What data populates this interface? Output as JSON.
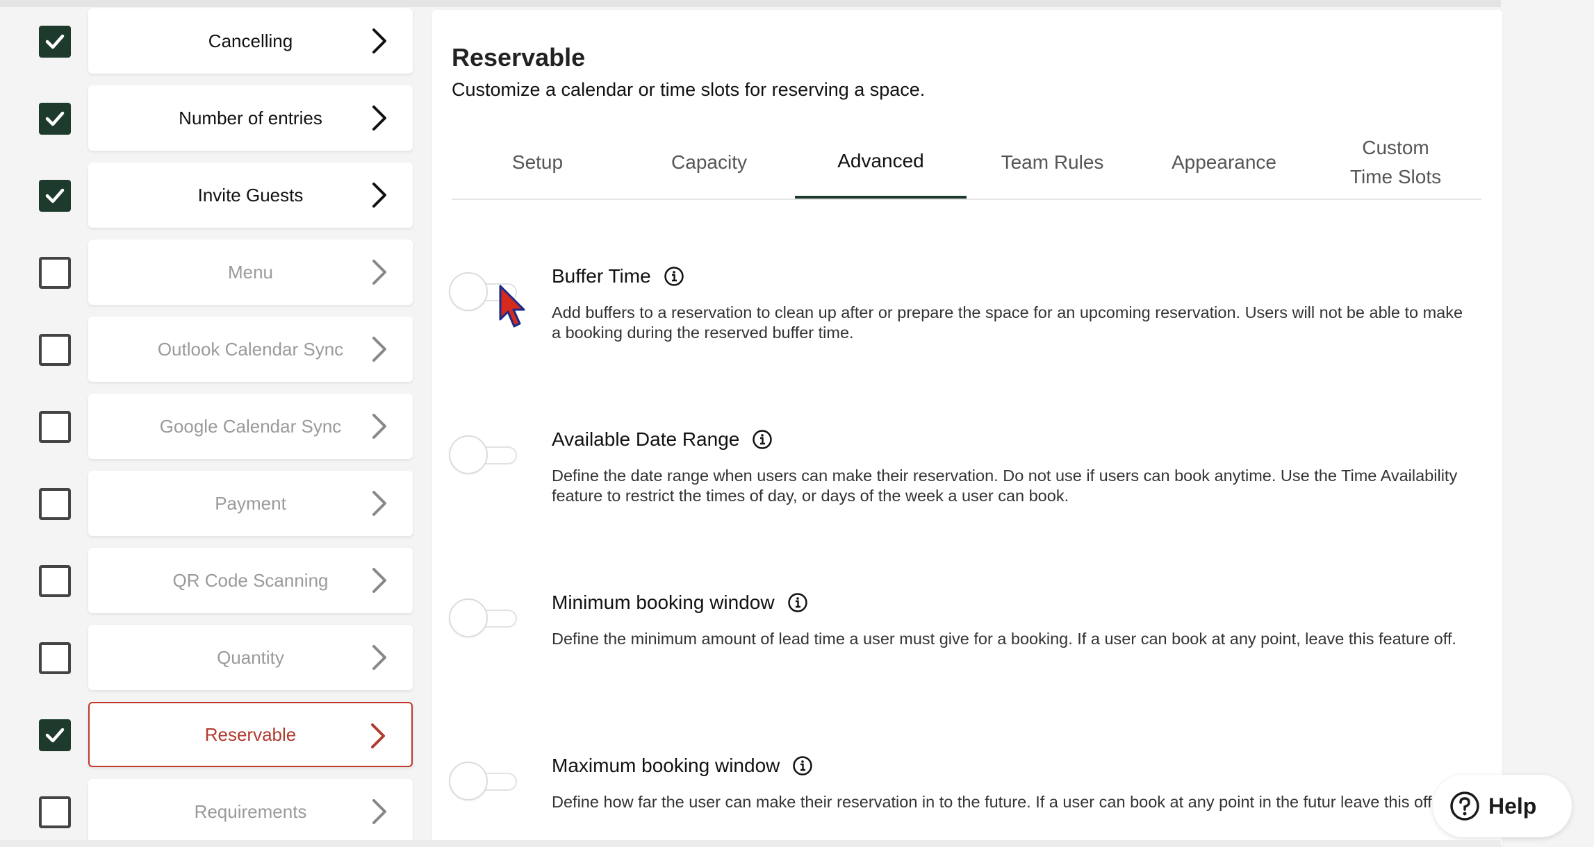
{
  "sidebar": {
    "items": [
      {
        "label": "Cancelling",
        "checked": true,
        "active": false
      },
      {
        "label": "Number of entries",
        "checked": true,
        "active": false
      },
      {
        "label": "Invite Guests",
        "checked": true,
        "active": false
      },
      {
        "label": "Menu",
        "checked": false,
        "active": false
      },
      {
        "label": "Outlook Calendar Sync",
        "checked": false,
        "active": false
      },
      {
        "label": "Google Calendar Sync",
        "checked": false,
        "active": false
      },
      {
        "label": "Payment",
        "checked": false,
        "active": false
      },
      {
        "label": "QR Code Scanning",
        "checked": false,
        "active": false
      },
      {
        "label": "Quantity",
        "checked": false,
        "active": false
      },
      {
        "label": "Reservable",
        "checked": true,
        "active": true
      },
      {
        "label": "Requirements",
        "checked": false,
        "active": false
      }
    ]
  },
  "main": {
    "title": "Reservable",
    "subtitle": "Customize a calendar or time slots for reserving a space.",
    "tabs": [
      {
        "label": "Setup",
        "active": false
      },
      {
        "label": "Capacity",
        "active": false
      },
      {
        "label": "Advanced",
        "active": true
      },
      {
        "label": "Team Rules",
        "active": false
      },
      {
        "label": "Appearance",
        "active": false
      },
      {
        "label": "Custom\nTime Slots",
        "active": false
      }
    ],
    "settings": [
      {
        "title": "Buffer Time",
        "description": "Add buffers to a reservation to clean up after or prepare the space for an upcoming reservation. Users will not be able to make a booking during the reserved buffer time.",
        "enabled": false
      },
      {
        "title": "Available Date Range",
        "description": "Define the date range when users can make their reservation. Do not use if users can book anytime. Use the Time Availability feature to restrict the times of day, or days of the week a user can book.",
        "enabled": false
      },
      {
        "title": "Minimum booking window",
        "description": "Define the minimum amount of lead time a user must give for a booking. If a user can book at any point, leave this feature off.",
        "enabled": false
      },
      {
        "title": "Maximum booking window",
        "description": "Define how far the user can make their reservation in to the future. If a user can book at any point in the futur leave this off.",
        "enabled": false
      }
    ]
  },
  "help": {
    "label": "Help"
  },
  "colors": {
    "accent": "#1d3a2c",
    "active_red": "#b03a2e",
    "cursor": "#d62a1e"
  }
}
